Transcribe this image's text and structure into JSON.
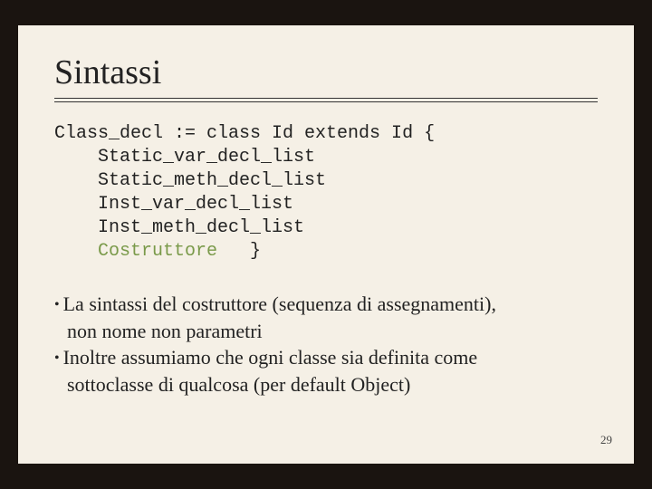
{
  "title": "Sintassi",
  "grammar": {
    "l1": "Class_decl := class Id extends Id {",
    "l2": "    Static_var_decl_list",
    "l3": "    Static_meth_decl_list",
    "l4": "    Inst_var_decl_list",
    "l5": "    Inst_meth_decl_list",
    "l6a": "    ",
    "l6b": "Costruttore",
    "l6c": "   }"
  },
  "bullets": {
    "b1a": "La sintassi del costruttore (sequenza di assegnamenti),",
    "b1b": "non nome non parametri",
    "b2a": "Inoltre assumiamo che ogni classe sia definita come",
    "b2b": "sottoclasse di qualcosa (per default Object)"
  },
  "page_number": "29"
}
